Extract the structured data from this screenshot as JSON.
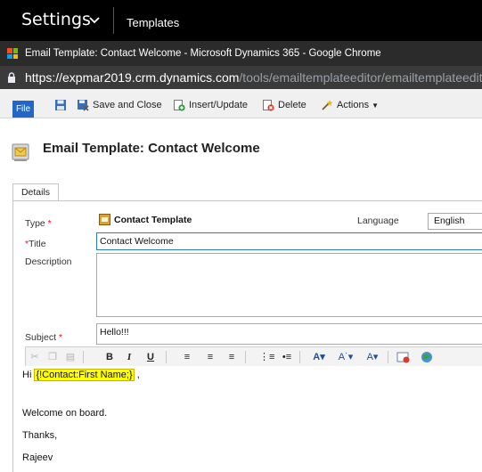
{
  "nav": {
    "app_title": "Settings",
    "breadcrumb": "Templates"
  },
  "browser": {
    "window_title": "Email Template: Contact Welcome - Microsoft Dynamics 365 - Google Chrome",
    "url_host": "https://expmar2019.crm.dynamics.com",
    "url_path": "/tools/emailtemplateeditor/emailtemplateedit"
  },
  "ribbon": {
    "file": "File",
    "save_close": "Save and Close",
    "insert_update": "Insert/Update",
    "delete": "Delete",
    "actions": "Actions"
  },
  "header": {
    "title": "Email Template: Contact Welcome"
  },
  "tabs": [
    "Details"
  ],
  "form": {
    "type_label": "Type",
    "type_value": "Contact Template",
    "language_label": "Language",
    "language_value": "English",
    "title_label": "Title",
    "title_value": "Contact Welcome",
    "description_label": "Description",
    "description_value": "",
    "subject_label": "Subject",
    "subject_value": "Hello!!!"
  },
  "editor": {
    "greeting": "Hi ",
    "token": "{!Contact:First Name;}",
    "greeting_suffix": " ,",
    "line2": "Welcome on board.",
    "line3": "Thanks,",
    "line4": "Rajeev"
  },
  "colors": {
    "accent": "#2266c8",
    "required": "#e81123",
    "token_highlight": "#ffff00"
  }
}
